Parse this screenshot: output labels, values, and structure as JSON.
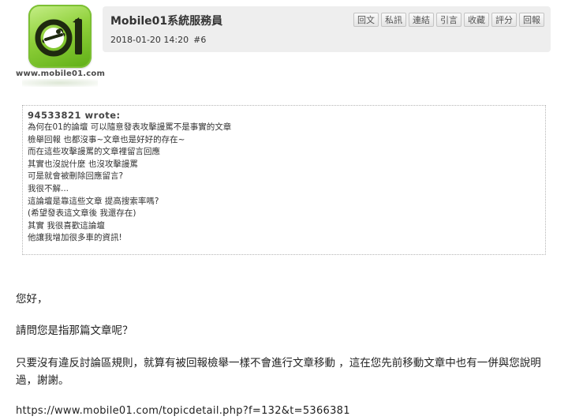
{
  "avatar": {
    "url_text": "www.mobile01.com"
  },
  "post": {
    "author": "Mobile01系統服務員",
    "date": "2018-01-20 14:20",
    "floor": "#6",
    "actions": [
      "回文",
      "私訊",
      "連結",
      "引言",
      "收藏",
      "評分",
      "回報"
    ]
  },
  "quote": {
    "author": "94533821 wrote:",
    "lines": [
      "為何在01的論壇 可以隨意發表攻擊謾罵不是事實的文章",
      "檢舉回報 也都沒事~文章也是好好的存在~",
      "而在這些攻擊謾罵的文章裡留言回應",
      "其實也沒說什麼 也沒攻擊謾罵",
      "可是就會被刪除回應留言?",
      "我很不解...",
      "這論壇是靠這些文章 提高搜索率嗎?",
      "(希望發表這文章後 我還存在)",
      "其實 我很喜歡這論壇",
      "他讓我增加很多車的資訊!"
    ]
  },
  "reply": {
    "greeting": "您好，",
    "question": "請問您是指那篇文章呢？",
    "explanation": "只要沒有違反討論區規則，就算有被回報檢舉一樣不會進行文章移動 ，這在您先前移動文章中也有一併與您說明過，謝謝。",
    "link": "https://www.mobile01.com/topicdetail.php?f=132&t=5366381"
  },
  "colors": {
    "logo_green": "#8fd03a",
    "header_bg": "#eeeeee"
  },
  "icons": {
    "avatar": "mobile01-logo-icon"
  }
}
